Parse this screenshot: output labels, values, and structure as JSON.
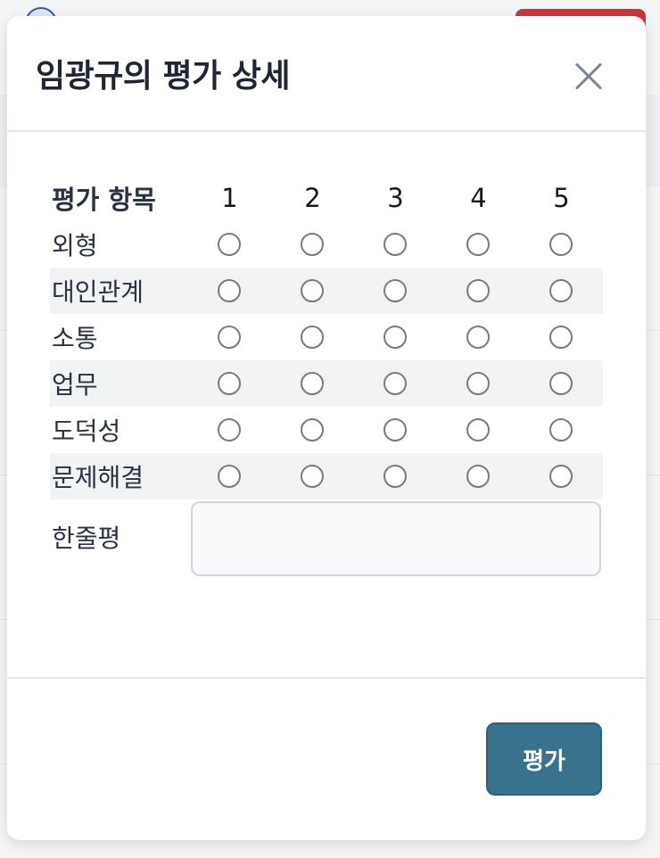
{
  "modal": {
    "title": "임광규의 평가 상세",
    "close_icon": "close-icon"
  },
  "table": {
    "header_item": "평가 항목",
    "scores": [
      "1",
      "2",
      "3",
      "4",
      "5"
    ],
    "rows": [
      {
        "label": "외형",
        "selected": null
      },
      {
        "label": "대인관계",
        "selected": null
      },
      {
        "label": "소통",
        "selected": null
      },
      {
        "label": "업무",
        "selected": null
      },
      {
        "label": "도덕성",
        "selected": null
      },
      {
        "label": "문제해결",
        "selected": null
      }
    ]
  },
  "comment": {
    "label": "한줄평",
    "value": "",
    "placeholder": ""
  },
  "footer": {
    "submit_label": "평가"
  },
  "colors": {
    "primary_button": "#38728d",
    "background_red_button": "#c9363a"
  }
}
